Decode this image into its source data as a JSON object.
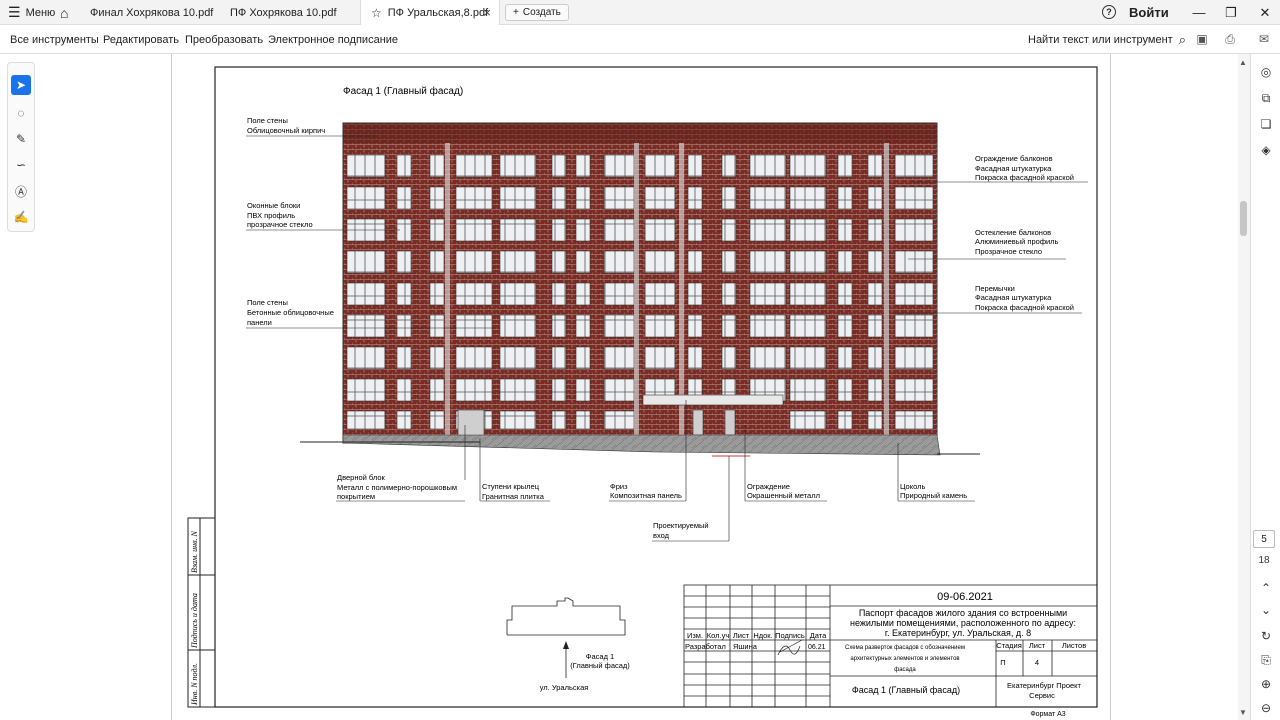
{
  "tabbar": {
    "menu_label": "Меню",
    "tabs": [
      {
        "label": "Финал Хохрякова 10.pdf"
      },
      {
        "label": "ПФ Хохрякова 10.pdf"
      },
      {
        "label": "ПФ Уральская,8.pdf",
        "active": true
      }
    ],
    "create_label": "Создать",
    "login_label": "Войти"
  },
  "toolbar": {
    "items": [
      "Все инструменты",
      "Редактировать",
      "Преобразовать",
      "Электронное подписание"
    ],
    "find_label": "Найти текст или инструмент"
  },
  "navigation": {
    "page_current": "5",
    "page_total": "18"
  },
  "document": {
    "facade_title": "Фасад 1 (Главный фасад)",
    "left_notes": [
      [
        "Поле стены",
        "Облицовочный кирпич"
      ],
      [
        "Оконные блоки",
        "ПВХ профиль",
        "прозрачное стекло"
      ],
      [
        "Поле стены",
        "Бетонные облицовочные",
        "панели"
      ]
    ],
    "right_notes": [
      [
        "Ограждение балконов",
        "Фасадная штукатурка",
        "Покраска фасадной краской"
      ],
      [
        "Остекление балконов",
        "Алюминиевый профиль",
        "Прозрачное стекло"
      ],
      [
        "Перемычки",
        "Фасадная штукатурка",
        "Покраска фасадной краской"
      ]
    ],
    "bottom_notes": [
      [
        "Дверной блок",
        "Металл с полимерно-порошковым",
        "покрытием"
      ],
      [
        "Ступени крылец",
        "Гранитная плитка"
      ],
      [
        "Фриз",
        "Композитная панель"
      ],
      [
        "Ограждение",
        "Окрашенный металл"
      ],
      [
        "Цоколь",
        "Природный камень"
      ]
    ],
    "entrance_note": [
      "Проектируемый",
      "вход"
    ],
    "plan_label": [
      "Фасад 1",
      "(Главный фасад)"
    ],
    "street_label": "ул. Уральская",
    "side_stamp": [
      "Инв. N подл.",
      "Подпись и дата",
      "Взам. инв. N"
    ],
    "title_block": {
      "date": "09-06.2021",
      "project_title": [
        "Паспорт фасадов жилого здания со встроенными",
        "нежилыми помещениями, расположенного по адресу:",
        "г. Екатеринбург, ул. Уральская, д. 8"
      ],
      "headers": [
        "Изм.",
        "Кол.уч",
        "Лист",
        "Ндок.",
        "Подпись",
        "Дата"
      ],
      "role": "Разработал",
      "name": "Яшина",
      "sign_date": "06.21",
      "sheet_desc": [
        "Схема разверток фасадов с обозначением",
        "архитектурных элементов и элементов",
        "фасада"
      ],
      "stage_headers": [
        "Стадия",
        "Лист",
        "Листов"
      ],
      "stage_values": [
        "П",
        "4",
        ""
      ],
      "sheet_name": "Фасад 1 (Главный фасад)",
      "company": [
        "Екатеринбург Проект",
        "Сервис"
      ],
      "format": "Формат А3"
    }
  }
}
